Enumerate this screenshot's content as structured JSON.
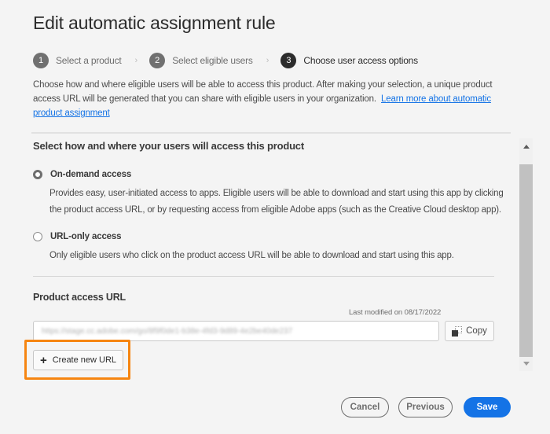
{
  "dialog": {
    "title": "Edit automatic assignment rule"
  },
  "stepper": {
    "steps": [
      {
        "number": "1",
        "label": "Select a product",
        "state": "completed"
      },
      {
        "number": "2",
        "label": "Select eligible users",
        "state": "completed"
      },
      {
        "number": "3",
        "label": "Choose user access options",
        "state": "active"
      }
    ],
    "separator_icon": "chevron-right-icon"
  },
  "intro": {
    "text": "Choose how and where eligible users will be able to access this product. After making your selection, a unique product access URL will be generated that you can share with eligible users in your organization.",
    "link_label": "Learn more about automatic product assignment"
  },
  "access_section": {
    "title": "Select how and where your users will access this product",
    "options": [
      {
        "label": "On-demand access",
        "selected": true,
        "description": "Provides easy, user-initiated access to apps. Eligible users will be able to download and start using this app by clicking the product access URL, or by requesting access from eligible Adobe apps (such as the Creative Cloud desktop app)."
      },
      {
        "label": "URL-only access",
        "selected": false,
        "description": "Only eligible users who click on the product access URL will be able to download and start using this app."
      }
    ]
  },
  "url_section": {
    "title": "Product access URL",
    "last_modified": "Last modified on 08/17/2022",
    "url_value": "https://stage.cc.adobe.com/go/8f9f0de1-b38e-4fd3-9d89-4e2be40de237",
    "url_blurred": true,
    "copy_label": "Copy",
    "create_label": "Create new URL"
  },
  "highlight": {
    "color": "#f68511",
    "target": "create-new-url-button"
  },
  "footer": {
    "cancel_label": "Cancel",
    "previous_label": "Previous",
    "save_label": "Save"
  },
  "colors": {
    "accent": "#1473e6",
    "highlight": "#f68511",
    "background": "#f4f4f4"
  }
}
